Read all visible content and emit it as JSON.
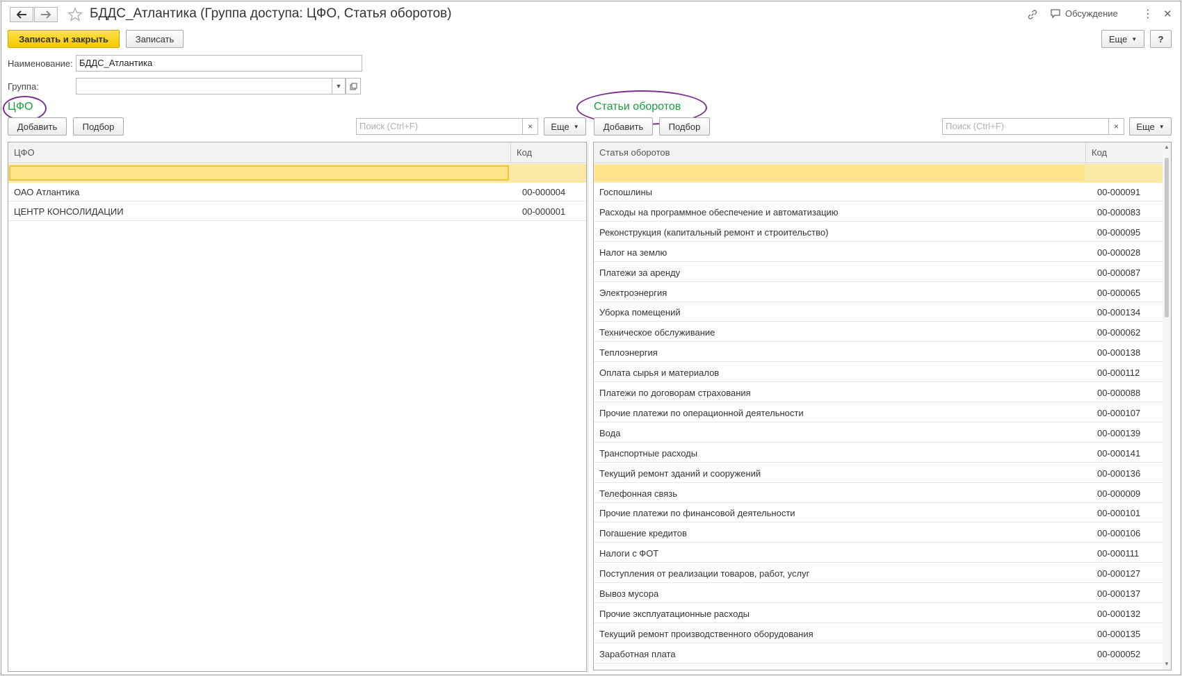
{
  "window": {
    "title": "БДДС_Атлантика (Группа доступа: ЦФО, Статья оборотов)",
    "discussion_label": "Обсуждение"
  },
  "toolbar": {
    "save_close_label": "Записать и закрыть",
    "save_label": "Записать",
    "more_label": "Еще",
    "help_label": "?"
  },
  "form": {
    "name_label": "Наименование:",
    "name_value": "БДДС_Атлантика",
    "group_label": "Группа:",
    "group_value": ""
  },
  "cfo": {
    "section_title": "ЦФО",
    "add_label": "Добавить",
    "pick_label": "Подбор",
    "search_placeholder": "Поиск (Ctrl+F)",
    "more_label": "Еще",
    "columns": [
      "ЦФО",
      "Код"
    ],
    "rows": [
      {
        "name": "ОАО Атлантика",
        "code": "00-000004"
      },
      {
        "name": "ЦЕНТР КОНСОЛИДАЦИИ",
        "code": "00-000001"
      }
    ]
  },
  "items": {
    "section_title": "Статьи оборотов",
    "add_label": "Добавить",
    "pick_label": "Подбор",
    "search_placeholder": "Поиск (Ctrl+F)",
    "more_label": "Еще",
    "columns": [
      "Статья оборотов",
      "Код"
    ],
    "rows": [
      {
        "name": "Госпошлины",
        "code": "00-000091"
      },
      {
        "name": "Расходы на программное обеспечение и автоматизацию",
        "code": "00-000083"
      },
      {
        "name": "Реконструкция (капитальный ремонт и строительство)",
        "code": "00-000095"
      },
      {
        "name": "Налог на землю",
        "code": "00-000028"
      },
      {
        "name": "Платежи за аренду",
        "code": "00-000087"
      },
      {
        "name": "Электроэнергия",
        "code": "00-000065"
      },
      {
        "name": "Уборка помещений",
        "code": "00-000134"
      },
      {
        "name": "Техническое обслуживание",
        "code": "00-000062"
      },
      {
        "name": "Теплоэнергия",
        "code": "00-000138"
      },
      {
        "name": "Оплата сырья и материалов",
        "code": "00-000112"
      },
      {
        "name": "Платежи по договорам страхования",
        "code": "00-000088"
      },
      {
        "name": "Прочие платежи по операционной деятельности",
        "code": "00-000107"
      },
      {
        "name": "Вода",
        "code": "00-000139"
      },
      {
        "name": "Транспортные расходы",
        "code": "00-000141"
      },
      {
        "name": "Текущий ремонт зданий и сооружений",
        "code": "00-000136"
      },
      {
        "name": "Телефонная связь",
        "code": "00-000009"
      },
      {
        "name": "Прочие платежи по финансовой деятельности",
        "code": "00-000101"
      },
      {
        "name": "Погашение кредитов",
        "code": "00-000106"
      },
      {
        "name": "Налоги с ФОТ",
        "code": "00-000111"
      },
      {
        "name": "Поступления от реализации товаров, работ, услуг",
        "code": "00-000127"
      },
      {
        "name": "Вывоз мусора",
        "code": "00-000137"
      },
      {
        "name": "Прочие эксплуатационные расходы",
        "code": "00-000132"
      },
      {
        "name": "Текущий ремонт производственного оборудования",
        "code": "00-000135"
      },
      {
        "name": "Заработная плата",
        "code": "00-000052"
      }
    ]
  },
  "colors": {
    "accent_yellow": "#f5c800",
    "section_green": "#1a9f3a",
    "highlight_ring": "#7a2f8f",
    "selected_row": "#fde48b"
  }
}
